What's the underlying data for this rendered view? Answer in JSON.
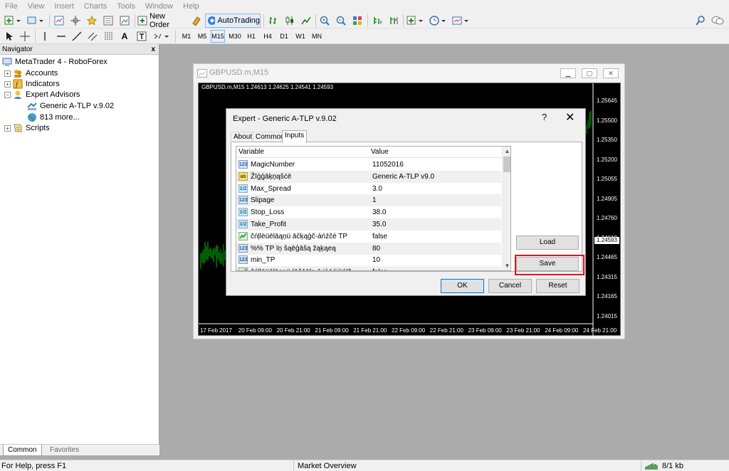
{
  "menu": [
    "File",
    "View",
    "Insert",
    "Charts",
    "Tools",
    "Window",
    "Help"
  ],
  "toolbar": {
    "new_order": "New Order",
    "autotrading": "AutoTrading",
    "timeframes": [
      "M1",
      "M5",
      "M15",
      "M30",
      "H1",
      "H4",
      "D1",
      "W1",
      "MN"
    ],
    "selected_timeframe": "M15"
  },
  "navigator": {
    "title": "Navigator",
    "close": "x",
    "root": "MetaTrader 4 - RoboForex",
    "items": [
      "Accounts",
      "Indicators",
      "Expert Advisors",
      "Scripts"
    ],
    "ea_children": [
      "Generic A-TLP v.9.02",
      "813 more..."
    ],
    "tabs": [
      "Common",
      "Favorites"
    ]
  },
  "chart": {
    "window_title": "GBPUSD.m,M15",
    "info": "GBPUSD.m,M15  1.24613 1.24625 1.24541 1.24593",
    "prices": [
      "1.25645",
      "1.25500",
      "1.25350",
      "1.25200",
      "1.25055",
      "1.24905",
      "1.24760",
      "1.24610",
      "1.24465",
      "1.24315",
      "1.24165",
      "1.24015"
    ],
    "current_price": "1.24593",
    "dates": [
      "17 Feb 2017",
      "20 Feb 09:00",
      "20 Feb 21:00",
      "21 Feb 09:00",
      "21 Feb 21:00",
      "22 Feb 09:00",
      "22 Feb 21:00",
      "23 Feb 09:00",
      "23 Feb 21:00",
      "24 Feb 09:00",
      "24 Feb 21:00"
    ],
    "up_color": "#00c000",
    "bg_color": "#000000"
  },
  "dialog": {
    "title": "Expert - Generic A-TLP v.9.02",
    "help": "?",
    "close": "✕",
    "tabs": [
      "About",
      "Common",
      "Inputs"
    ],
    "active_tab": "Inputs",
    "headers": {
      "variable": "Variable",
      "value": "Value"
    },
    "rows": [
      {
        "type": "123",
        "name": "MagicNumber",
        "value": "11052016"
      },
      {
        "type": "ab",
        "name": "Žīģģāķņąšćē",
        "value": "Generic A-TLP v9.0"
      },
      {
        "type": "1/2",
        "name": "Max_Spread",
        "value": "3.0"
      },
      {
        "type": "123",
        "name": "Slipage",
        "value": "1"
      },
      {
        "type": "1/2",
        "name": "Stop_Loss",
        "value": "38.0"
      },
      {
        "type": "1/2",
        "name": "Take_Profit",
        "value": "35.0"
      },
      {
        "type": "bool",
        "name": "čńļlëüēlāąņü āčķąģč-áńźčé TP",
        "value": "false"
      },
      {
        "type": "123",
        "name": "%% TP īņ šąēģāšą žąķąeą",
        "value": "80"
      },
      {
        "type": "123",
        "name": "min_TP",
        "value": "10"
      },
      {
        "type": "bool",
        "name": "čńļlëüēlāąņü lāšāāla ā iáëóiūńīž",
        "value": "false"
      }
    ],
    "buttons": {
      "load": "Load",
      "save": "Save",
      "ok": "OK",
      "cancel": "Cancel",
      "reset": "Reset"
    }
  },
  "status": {
    "help": "For Help, press F1",
    "profile": "Market Overview",
    "traffic": "8/1 kb"
  },
  "highlight_color": "#e0151b"
}
